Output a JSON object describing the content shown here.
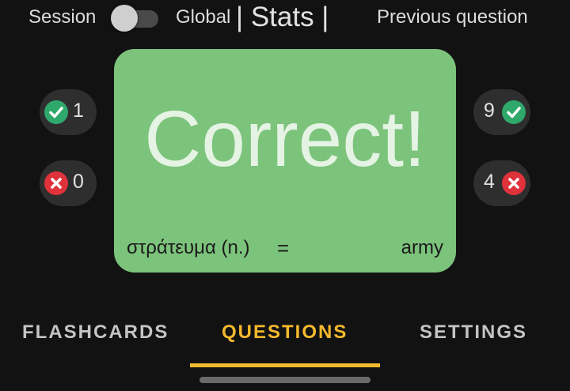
{
  "header": {
    "session_label": "Session",
    "global_label": "Global",
    "stats_label": "| Stats |",
    "previous_question_label": "Previous question",
    "toggle_on": false
  },
  "session_stats": {
    "correct": "1",
    "incorrect": "0"
  },
  "global_stats": {
    "correct": "9",
    "incorrect": "4"
  },
  "card": {
    "result": "Correct!",
    "word": "στράτευμα (n.)",
    "equals": "=",
    "translation": "army",
    "background_color": "#7cc37b"
  },
  "tabs": [
    {
      "label": "FLASHCARDS",
      "active": false
    },
    {
      "label": "QUESTIONS",
      "active": true
    },
    {
      "label": "SETTINGS",
      "active": false
    }
  ],
  "colors": {
    "accent": "#f4b92c",
    "correct": "#2ea86b",
    "incorrect": "#e0323a"
  },
  "icons": {
    "correct": "check-circle-icon",
    "incorrect": "x-circle-icon"
  }
}
